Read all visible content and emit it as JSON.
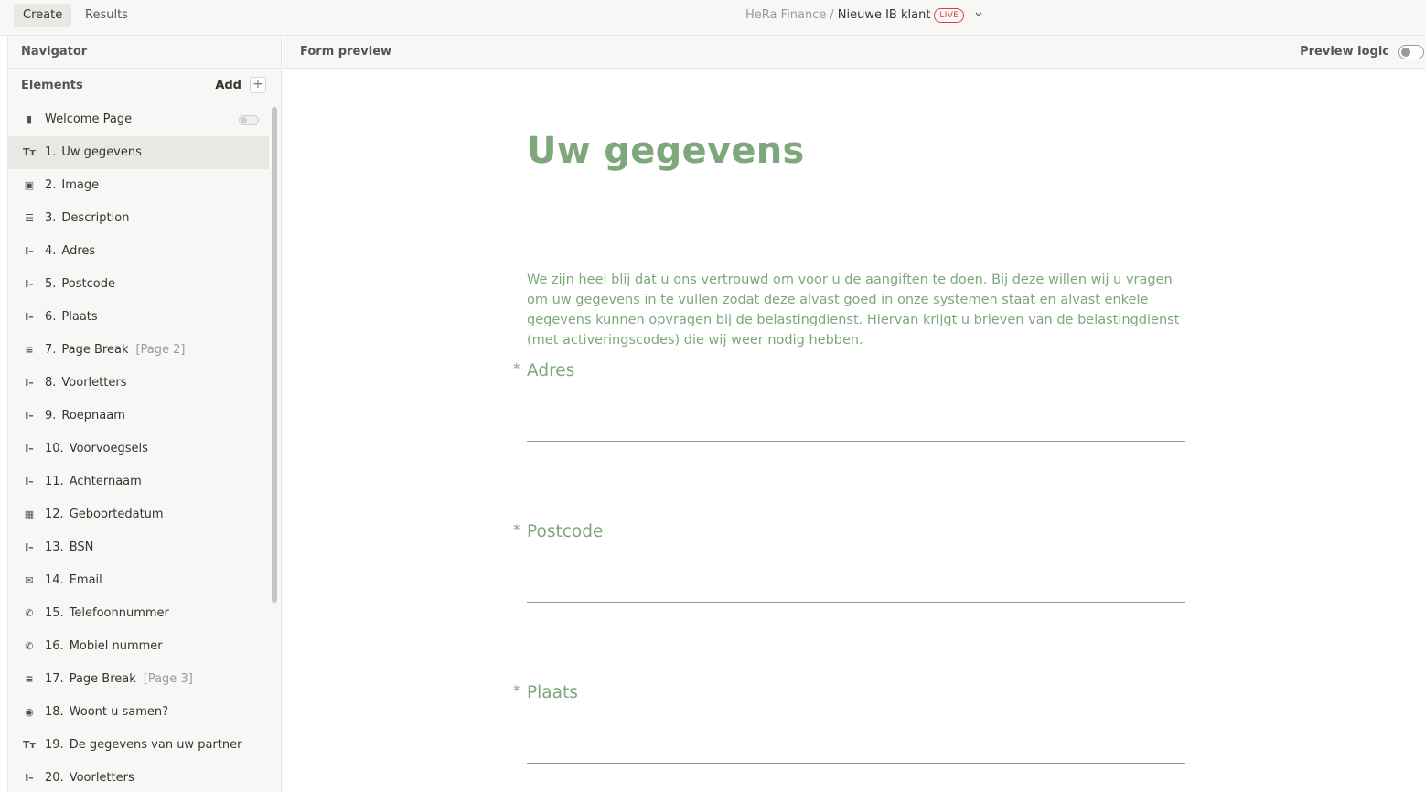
{
  "topbar": {
    "tabs": [
      {
        "label": "Create",
        "active": true
      },
      {
        "label": "Results",
        "active": false
      }
    ],
    "breadcrumb": {
      "workspace": "HeRa Finance",
      "separator": "/",
      "form_name": "Nieuwe IB klant",
      "status_badge": "LIVE"
    }
  },
  "sidebar": {
    "navigator_label": "Navigator",
    "elements_label": "Elements",
    "add_label": "Add",
    "add_icon": "+",
    "items": [
      {
        "num": "",
        "label": "Welcome Page",
        "icon": "welcome-page-icon",
        "glyph": "▮",
        "page_tag": ""
      },
      {
        "num": "1.",
        "label": "Uw gegevens",
        "icon": "heading-icon",
        "glyph": "Tт",
        "page_tag": ""
      },
      {
        "num": "2.",
        "label": "Image",
        "icon": "image-icon",
        "glyph": "▣",
        "page_tag": ""
      },
      {
        "num": "3.",
        "label": "Description",
        "icon": "text-icon",
        "glyph": "☰",
        "page_tag": ""
      },
      {
        "num": "4.",
        "label": "Adres",
        "icon": "short-text-icon",
        "glyph": "I–",
        "page_tag": ""
      },
      {
        "num": "5.",
        "label": "Postcode",
        "icon": "short-text-icon",
        "glyph": "I–",
        "page_tag": ""
      },
      {
        "num": "6.",
        "label": "Plaats",
        "icon": "short-text-icon",
        "glyph": "I–",
        "page_tag": ""
      },
      {
        "num": "7.",
        "label": "Page Break",
        "icon": "page-break-icon",
        "glyph": "≡",
        "page_tag": "[Page 2]"
      },
      {
        "num": "8.",
        "label": "Voorletters",
        "icon": "short-text-icon",
        "glyph": "I–",
        "page_tag": ""
      },
      {
        "num": "9.",
        "label": "Roepnaam",
        "icon": "short-text-icon",
        "glyph": "I–",
        "page_tag": ""
      },
      {
        "num": "10.",
        "label": "Voorvoegsels",
        "icon": "short-text-icon",
        "glyph": "I–",
        "page_tag": ""
      },
      {
        "num": "11.",
        "label": "Achternaam",
        "icon": "short-text-icon",
        "glyph": "I–",
        "page_tag": ""
      },
      {
        "num": "12.",
        "label": "Geboortedatum",
        "icon": "calendar-icon",
        "glyph": "▦",
        "page_tag": ""
      },
      {
        "num": "13.",
        "label": "BSN",
        "icon": "short-text-icon",
        "glyph": "I–",
        "page_tag": ""
      },
      {
        "num": "14.",
        "label": "Email",
        "icon": "email-icon",
        "glyph": "✉",
        "page_tag": ""
      },
      {
        "num": "15.",
        "label": "Telefoonnummer",
        "icon": "phone-icon",
        "glyph": "✆",
        "page_tag": ""
      },
      {
        "num": "16.",
        "label": "Mobiel nummer",
        "icon": "phone-icon",
        "glyph": "✆",
        "page_tag": ""
      },
      {
        "num": "17.",
        "label": "Page Break",
        "icon": "page-break-icon",
        "glyph": "≡",
        "page_tag": "[Page 3]"
      },
      {
        "num": "18.",
        "label": "Woont u samen?",
        "icon": "radio-icon",
        "glyph": "◉",
        "page_tag": ""
      },
      {
        "num": "19.",
        "label": "De gegevens van uw partner",
        "icon": "heading-icon",
        "glyph": "Tт",
        "page_tag": ""
      },
      {
        "num": "20.",
        "label": "Voorletters",
        "icon": "short-text-icon",
        "glyph": "I–",
        "page_tag": ""
      }
    ]
  },
  "main": {
    "header_label": "Form preview",
    "preview_logic_label": "Preview logic",
    "preview_logic_on": false
  },
  "form": {
    "title": "Uw gegevens",
    "description": "We zijn heel blij dat u ons vertrouwd om voor u de aangiften te doen. Bij deze willen wij u vragen om uw gegevens in te vullen zodat deze alvast goed in onze systemen staat en alvast enkele gegevens kunnen opvragen bij de belastingdienst. Hiervan krijgt u brieven van de belastingdienst (met activeringscodes) die wij weer nodig hebben.",
    "required_marker": "*",
    "questions": [
      {
        "label": "Adres",
        "value": ""
      },
      {
        "label": "Postcode",
        "value": ""
      },
      {
        "label": "Plaats",
        "value": ""
      }
    ]
  },
  "colors": {
    "accent_green": "#7ea77b",
    "live_red": "#e03e3e",
    "sidebar_bg": "#f7f7f5"
  }
}
